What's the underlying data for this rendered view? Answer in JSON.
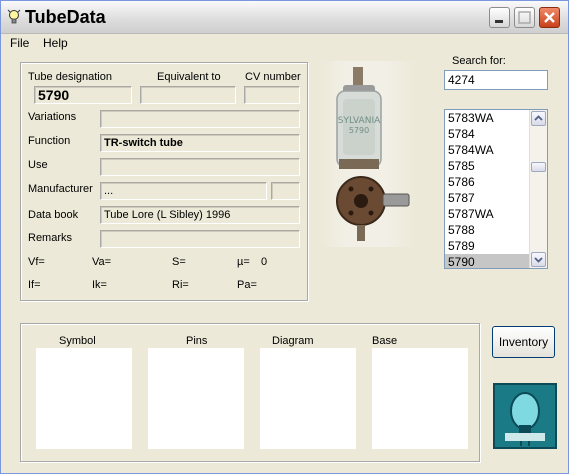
{
  "window": {
    "title": "TubeData"
  },
  "menu": {
    "file": "File",
    "help": "Help"
  },
  "details": {
    "tube_designation_label": "Tube designation",
    "equivalent_to_label": "Equivalent to",
    "cv_number_label": "CV number",
    "tube_designation_value": "5790",
    "equivalent_to_value": "",
    "cv_number_value": "",
    "variations_label": "Variations",
    "variations_value": "",
    "function_label": "Function",
    "function_value": "TR-switch tube",
    "use_label": "Use",
    "use_value": "",
    "manufacturer_label": "Manufacturer",
    "manufacturer_value": "...",
    "manufacturer_code": "",
    "data_book_label": "Data book",
    "data_book_value": "Tube Lore (L Sibley) 1996",
    "remarks_label": "Remarks",
    "remarks_value": "",
    "params_row1": [
      "Vf=",
      "Va=",
      "S=",
      "µ=",
      "0"
    ],
    "params_row2": [
      "If=",
      "Ik=",
      "Ri=",
      "Pa="
    ]
  },
  "search": {
    "label": "Search for:",
    "value": "4274"
  },
  "tube_list": {
    "items": [
      "5783WA",
      "5784",
      "5784WA",
      "5785",
      "5786",
      "5787",
      "5787WA",
      "5788",
      "5789",
      "5790"
    ],
    "selected": "5790"
  },
  "panes": {
    "symbol": "Symbol",
    "pins": "Pins",
    "diagram": "Diagram",
    "base": "Base"
  },
  "buttons": {
    "inventory": "Inventory"
  },
  "colors": {
    "window_bg": "#ece9d8",
    "selection": "#c6c6c6",
    "close_button": "#c8401a",
    "logo_bg": "#1a7a86"
  }
}
